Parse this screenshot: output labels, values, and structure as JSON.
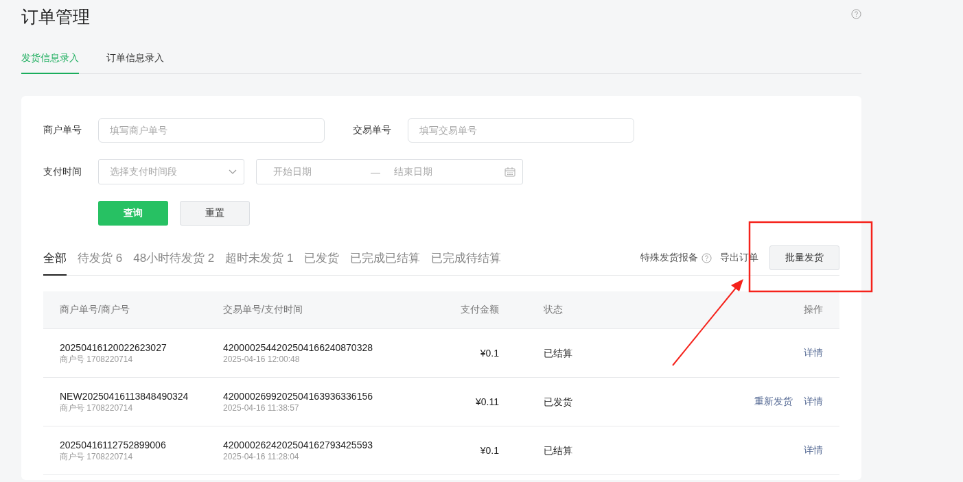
{
  "page": {
    "title": "订单管理"
  },
  "tabs": [
    {
      "label": "发货信息录入",
      "selected": true
    },
    {
      "label": "订单信息录入",
      "selected": false
    }
  ],
  "filters": {
    "merchant_order": {
      "label": "商户单号",
      "placeholder": "填写商户单号"
    },
    "trade_order": {
      "label": "交易单号",
      "placeholder": "填写交易单号"
    },
    "pay_time": {
      "label": "支付时间",
      "placeholder": "选择支付时间段"
    },
    "date_range": {
      "start_placeholder": "开始日期",
      "separator": "—",
      "end_placeholder": "结束日期"
    },
    "buttons": [
      {
        "label": "查询",
        "kind": "primary"
      },
      {
        "label": "重置",
        "kind": "default"
      }
    ]
  },
  "status_tabs": [
    {
      "label": "全部",
      "selected": true
    },
    {
      "label": "待发货 6",
      "selected": false
    },
    {
      "label": "48小时待发货 2",
      "selected": false
    },
    {
      "label": "超时未发货 1",
      "selected": false
    },
    {
      "label": "已发货",
      "selected": false
    },
    {
      "label": "已完成已结算",
      "selected": false
    },
    {
      "label": "已完成待结算",
      "selected": false
    }
  ],
  "actions": {
    "report_link": "特殊发货报备",
    "export_link": "导出订单",
    "batch_button": "批量发货"
  },
  "table": {
    "columns": [
      "商户单号/商户号",
      "交易单号/支付时间",
      "支付金额",
      "状态",
      "操作"
    ],
    "rows": [
      {
        "merchant_order": "20250416120022623027",
        "merchant_id": "商户号 1708220714",
        "trade_order": "4200002544202504166240870328",
        "pay_time": "2025-04-16 12:00:48",
        "amount": "¥0.1",
        "status": "已结算",
        "actions": [
          "详情"
        ]
      },
      {
        "merchant_order": "NEW20250416113848490324",
        "merchant_id": "商户号 1708220714",
        "trade_order": "4200002699202504163936336156",
        "pay_time": "2025-04-16 11:38:57",
        "amount": "¥0.11",
        "status": "已发货",
        "actions": [
          "重新发货",
          "详情"
        ]
      },
      {
        "merchant_order": "20250416112752899006",
        "merchant_id": "商户号 1708220714",
        "trade_order": "4200002624202504162793425593",
        "pay_time": "2025-04-16 11:28:04",
        "amount": "¥0.1",
        "status": "已结算",
        "actions": [
          "详情"
        ]
      }
    ]
  }
}
